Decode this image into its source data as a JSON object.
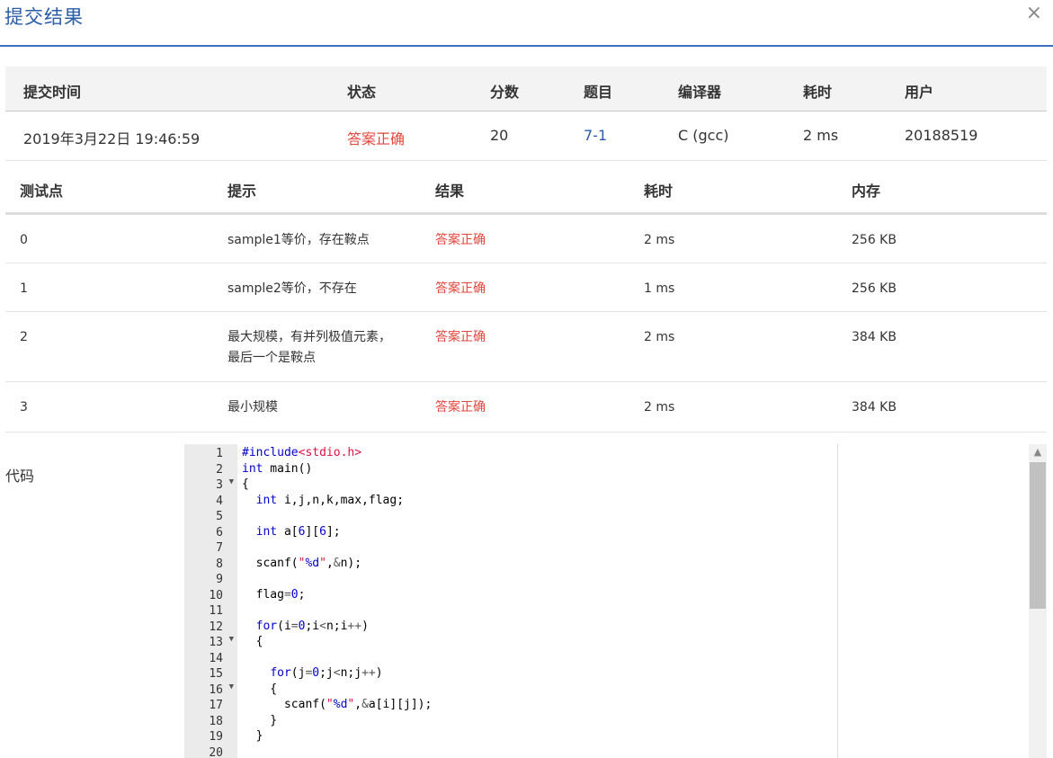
{
  "dialog": {
    "title": "提交结果",
    "close_icon": "×"
  },
  "summary": {
    "headers": [
      "提交时间",
      "状态",
      "分数",
      "题目",
      "编译器",
      "耗时",
      "用户"
    ],
    "row": {
      "time": "2019年3月22日 19:46:59",
      "status": "答案正确",
      "score": "20",
      "problem": "7-1",
      "compiler": "C (gcc)",
      "duration": "2 ms",
      "user": "20188519"
    }
  },
  "tests": {
    "headers": [
      "测试点",
      "提示",
      "结果",
      "耗时",
      "内存"
    ],
    "rows": [
      {
        "id": "0",
        "hint": "sample1等价，存在鞍点",
        "hint2": "",
        "result": "答案正确",
        "time": "2 ms",
        "memory": "256 KB"
      },
      {
        "id": "1",
        "hint": "sample2等价，不存在",
        "hint2": "",
        "result": "答案正确",
        "time": "1 ms",
        "memory": "256 KB"
      },
      {
        "id": "2",
        "hint": "最大规模，有并列极值元素，",
        "hint2": "最后一个是鞍点",
        "result": "答案正确",
        "time": "2 ms",
        "memory": "384 KB"
      },
      {
        "id": "3",
        "hint": "最小规模",
        "hint2": "",
        "result": "答案正确",
        "time": "2 ms",
        "memory": "384 KB"
      }
    ]
  },
  "code_label": "代码",
  "colors": {
    "accent": "#3a6fc4",
    "status_ok": "#e4463c",
    "link": "#2a5ca8"
  },
  "code": {
    "lines": [
      "#include<stdio.h>",
      "int main()",
      "{",
      "  int i,j,n,k,max,flag;",
      "",
      "  int a[6][6];",
      "",
      "  scanf(\"%d\",&n);",
      "",
      "  flag=0;",
      "",
      "  for(i=0;i<n;i++)",
      "  {",
      "",
      "    for(j=0;j<n;j++)",
      "    {",
      "      scanf(\"%d\",&a[i][j]);",
      "    }",
      "  }",
      ""
    ],
    "fold_lines": [
      3,
      13,
      16
    ]
  }
}
